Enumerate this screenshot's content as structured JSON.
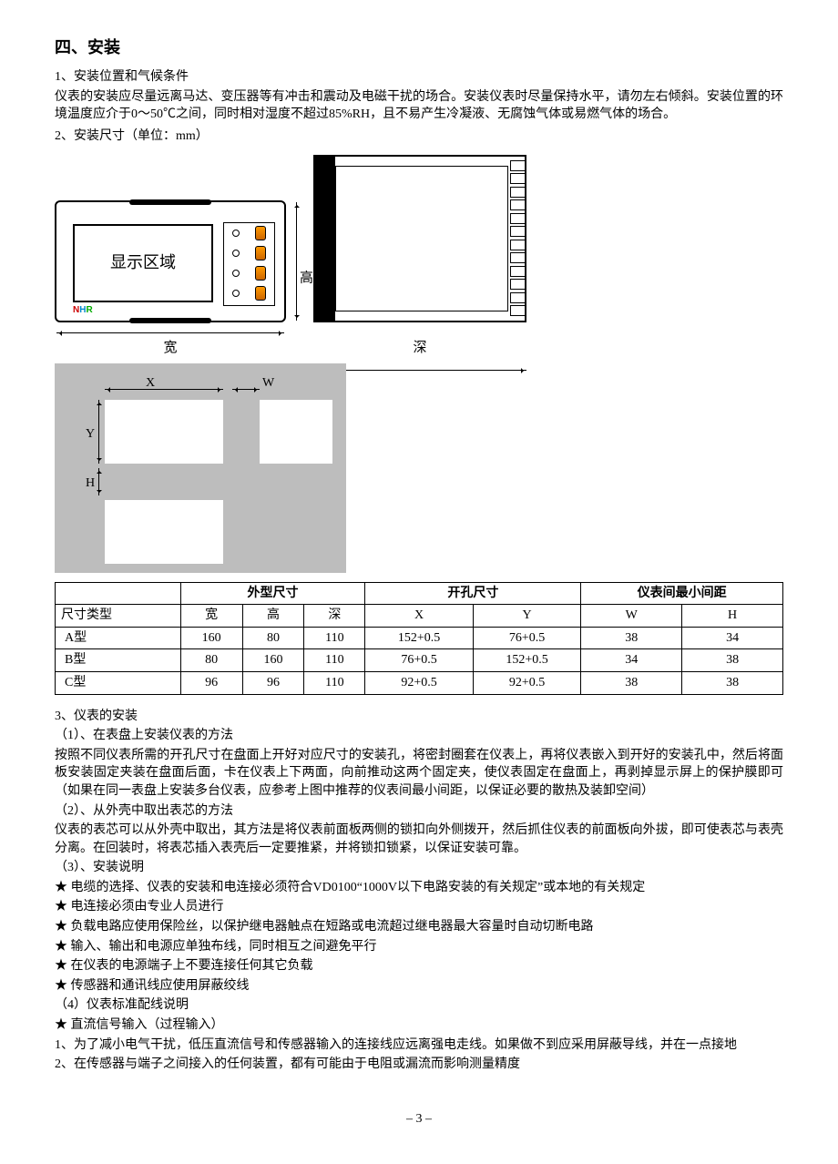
{
  "title": "四、安装",
  "sec1_head": "1、安装位置和气候条件",
  "sec1_body": "仪表的安装应尽量远离马达、变压器等有冲击和震动及电磁干扰的场合。安装仪表时尽量保持水平，请勿左右倾斜。安装位置的环境温度应介于0～50℃之间，同时相对湿度不超过85%RH，且不易产生冷凝液、无腐蚀气体或易燃气体的场合。",
  "sec2_head": "2、安装尺寸（单位：mm）",
  "front": {
    "screen_label": "显示区域",
    "width_label": "宽",
    "height_label": "高",
    "logo_n": "N",
    "logo_h": "H",
    "logo_r": "R"
  },
  "side": {
    "depth_label": "深"
  },
  "gray": {
    "X": "X",
    "W": "W",
    "Y": "Y",
    "H": "H"
  },
  "table": {
    "group1": "外型尺寸",
    "group2": "开孔尺寸",
    "group3": "仪表间最小间距",
    "col_type": "尺寸类型",
    "col_w": "宽",
    "col_h": "高",
    "col_d": "深",
    "col_X": "X",
    "col_Y": "Y",
    "col_W": "W",
    "col_H": "H",
    "rows": [
      {
        "type": "A型",
        "w": "160",
        "h": "80",
        "d": "110",
        "X": "152+0.5",
        "Y": "76+0.5",
        "W": "38",
        "H": "34"
      },
      {
        "type": "B型",
        "w": "80",
        "h": "160",
        "d": "110",
        "X": "76+0.5",
        "Y": "152+0.5",
        "W": "34",
        "H": "38"
      },
      {
        "type": "C型",
        "w": "96",
        "h": "96",
        "d": "110",
        "X": "92+0.5",
        "Y": "92+0.5",
        "W": "38",
        "H": "38"
      }
    ]
  },
  "sec3_head": "3、仪表的安装",
  "sec3_1_head": "（1）、在表盘上安装仪表的方法",
  "sec3_1_body": "按照不同仪表所需的开孔尺寸在盘面上开好对应尺寸的安装孔，将密封圈套在仪表上，再将仪表嵌入到开好的安装孔中，然后将面板安装固定夹装在盘面后面，卡在仪表上下两面，向前推动这两个固定夹，使仪表固定在盘面上，再剥掉显示屏上的保护膜即可（如果在同一表盘上安装多台仪表，应参考上图中推荐的仪表间最小间距，以保证必要的散热及装卸空间）",
  "sec3_2_head": "（2）、从外壳中取出表芯的方法",
  "sec3_2_body": "仪表的表芯可以从外壳中取出，其方法是将仪表前面板两侧的锁扣向外侧拨开，然后抓住仪表的前面板向外拔，即可使表芯与表壳分离。在回装时，将表芯插入表壳后一定要推紧，并将锁扣锁紧，以保证安装可靠。",
  "sec3_3_head": "（3）、安装说明",
  "stars": [
    "电缆的选择、仪表的安装和电连接必须符合VD0100“1000V以下电路安装的有关规定”或本地的有关规定",
    "电连接必须由专业人员进行",
    "负载电路应使用保险丝，以保护继电器触点在短路或电流超过继电器最大容量时自动切断电路",
    "输入、输出和电源应单独布线，同时相互之间避免平行",
    "在仪表的电源端子上不要连接任何其它负载",
    "传感器和通讯线应使用屏蔽绞线"
  ],
  "sec3_4_head": "（4）仪表标准配线说明",
  "sec3_4_star": "直流信号输入（过程输入）",
  "sec3_4_1": "1、为了减小电气干扰，低压直流信号和传感器输入的连接线应远离强电走线。如果做不到应采用屏蔽导线，并在一点接地",
  "sec3_4_2": "2、在传感器与端子之间接入的任何装置，都有可能由于电阻或漏流而影响测量精度",
  "page": "– 3 –"
}
